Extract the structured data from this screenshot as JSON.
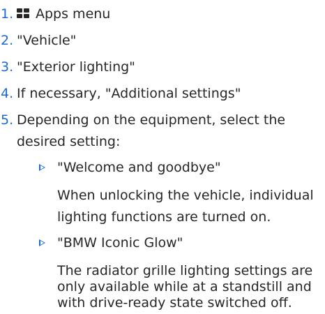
{
  "steps": [
    {
      "number": "1.",
      "text": "Apps menu",
      "icon": "apps-grid-icon"
    },
    {
      "number": "2.",
      "text": "\"Vehicle\""
    },
    {
      "number": "3.",
      "text": "\"Exterior lighting\""
    },
    {
      "number": "4.",
      "text": "If necessary, \"Additional settings\""
    },
    {
      "number": "5.",
      "lines": [
        "Depending on the equipment, select the",
        "desired setting:"
      ]
    }
  ],
  "options": [
    {
      "marker_icon": "triangle-arrow-icon",
      "title": "\"Welcome and goodbye\"",
      "description_lines": [
        "When unlocking the vehicle, individual",
        "lighting functions are turned on."
      ]
    },
    {
      "marker_icon": "triangle-arrow-icon",
      "title": "\"BMW Iconic Glow\"",
      "description_lines": [
        "The radiator grille lighting settings are",
        "only available while at a standstill and",
        "with drive-ready state switched off."
      ]
    }
  ],
  "colors": {
    "accent": "#1c69d4",
    "text": "#262626"
  }
}
